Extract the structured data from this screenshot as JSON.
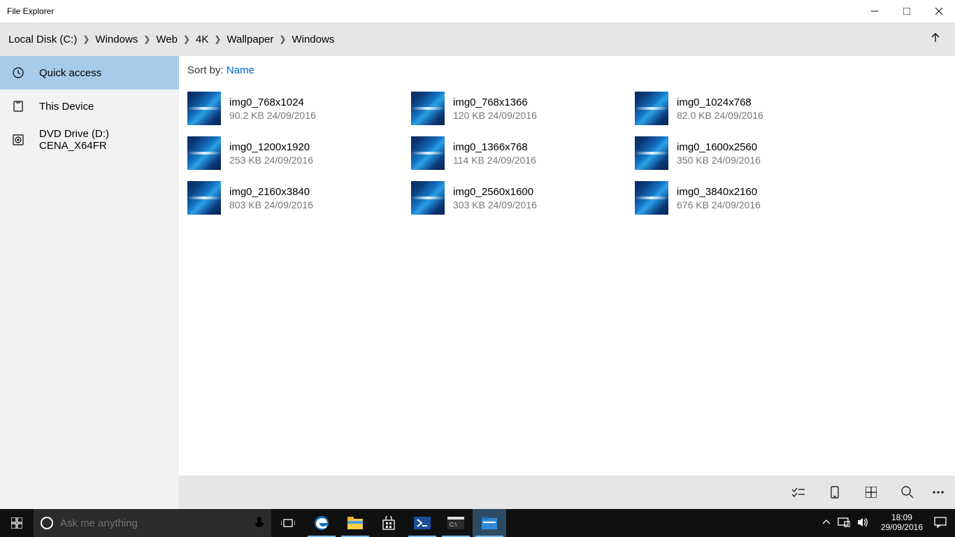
{
  "window": {
    "title": "File Explorer"
  },
  "breadcrumb": {
    "items": [
      "Local Disk (C:)",
      "Windows",
      "Web",
      "4K",
      "Wallpaper",
      "Windows"
    ]
  },
  "sidebar": {
    "items": [
      {
        "id": "quick-access",
        "label": "Quick access",
        "selected": true
      },
      {
        "id": "this-device",
        "label": "This Device",
        "selected": false
      },
      {
        "id": "dvd-drive",
        "label": "DVD Drive (D:) CENA_X64FR",
        "selected": false
      }
    ]
  },
  "sort": {
    "label": "Sort by:",
    "value": "Name"
  },
  "files": [
    {
      "name": "img0_768x1024",
      "size": "90.2 KB",
      "date": "24/09/2016"
    },
    {
      "name": "img0_768x1366",
      "size": "120 KB",
      "date": "24/09/2016"
    },
    {
      "name": "img0_1024x768",
      "size": "82.0 KB",
      "date": "24/09/2016"
    },
    {
      "name": "img0_1200x1920",
      "size": "253 KB",
      "date": "24/09/2016"
    },
    {
      "name": "img0_1366x768",
      "size": "114 KB",
      "date": "24/09/2016"
    },
    {
      "name": "img0_1600x2560",
      "size": "350 KB",
      "date": "24/09/2016"
    },
    {
      "name": "img0_2160x3840",
      "size": "803 KB",
      "date": "24/09/2016"
    },
    {
      "name": "img0_2560x1600",
      "size": "303 KB",
      "date": "24/09/2016"
    },
    {
      "name": "img0_3840x2160",
      "size": "676 KB",
      "date": "24/09/2016"
    }
  ],
  "taskbar": {
    "search_placeholder": "Ask me anything",
    "clock_time": "18:09",
    "clock_date": "29/09/2016"
  }
}
